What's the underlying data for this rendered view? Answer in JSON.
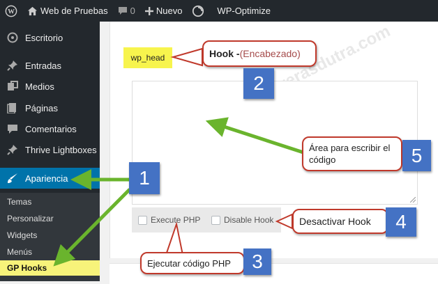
{
  "adminbar": {
    "site_name": "Web de Pruebas",
    "comments_count": "0",
    "new_label": "Nuevo",
    "plugin_label": "WP-Optimize"
  },
  "sidebar": {
    "items": [
      {
        "label": "Escritorio",
        "icon": "dashboard-icon"
      },
      {
        "label": "Entradas",
        "icon": "pushpin-icon"
      },
      {
        "label": "Medios",
        "icon": "media-icon"
      },
      {
        "label": "Páginas",
        "icon": "pages-icon"
      },
      {
        "label": "Comentarios",
        "icon": "comments-icon"
      },
      {
        "label": "Thrive Lightboxes",
        "icon": "pushpin-icon"
      },
      {
        "label": "Apariencia",
        "icon": "brush-icon"
      }
    ],
    "submenu": [
      "Temas",
      "Personalizar",
      "Widgets",
      "Menús",
      "GP Hooks"
    ]
  },
  "editor": {
    "hook_name": "wp_head",
    "execute_php_label": "Execute PHP",
    "disable_hook_label": "Disable Hook"
  },
  "annotations": {
    "title_bold": "Hook - ",
    "title_paren": "(Encabezado)",
    "area_label": "Área para escribir el código",
    "disable_label": "Desactivar Hook",
    "execute_label": "Ejecutar código PHP",
    "numbers": [
      "1",
      "2",
      "3",
      "4",
      "5"
    ]
  },
  "watermark": "www.miguelcarrerasdutra.com",
  "colors": {
    "adminbar_bg": "#23282d",
    "menu_current": "#0073aa",
    "highlight_yellow": "#f7f44d",
    "callout_border": "#c0392b",
    "number_box": "#4472c4",
    "arrow_green": "#6ab42d"
  }
}
